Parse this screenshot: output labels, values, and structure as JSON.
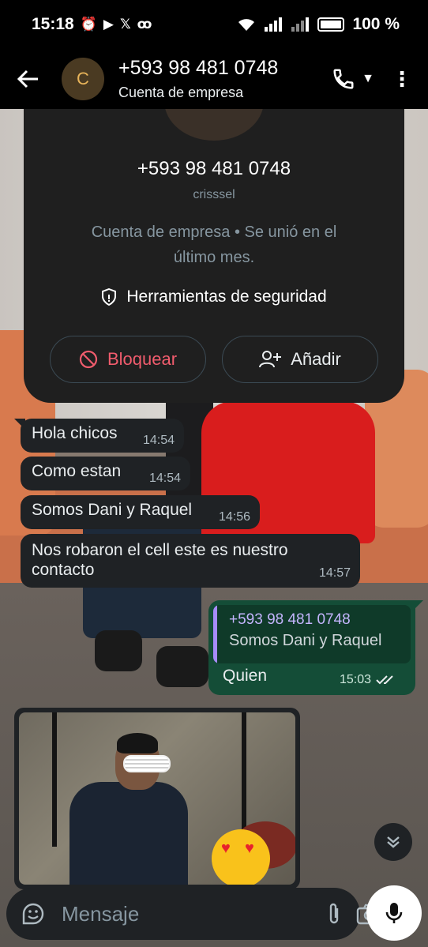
{
  "status_bar": {
    "time": "15:18",
    "battery": "100 %",
    "icons": [
      "alarm-icon",
      "youtube-icon",
      "x-icon",
      "voicemail-icon",
      "wifi-icon",
      "signal-icon",
      "signal-icon",
      "battery-icon"
    ]
  },
  "header": {
    "avatar_letter": "C",
    "title": "+593 98 481 0748",
    "subtitle": "Cuenta de empresa"
  },
  "contact_card": {
    "phone": "+593 98 481 0748",
    "name": "crisssel",
    "description": "Cuenta de empresa • Se unió en el último mes.",
    "security_label": "Herramientas de seguridad",
    "block_label": "Bloquear",
    "add_label": "Añadir"
  },
  "messages": [
    {
      "text": "Hola chicos",
      "time": "14:54"
    },
    {
      "text": "Como estan",
      "time": "14:54"
    },
    {
      "text": "Somos Dani y Raquel",
      "time": "14:56"
    },
    {
      "text": "Nos robaron el cell este es nuestro contacto",
      "time": "14:57"
    }
  ],
  "outgoing": {
    "quote_name": "+593 98 481 0748",
    "quote_text": "Somos Dani y Raquel",
    "text": "Quien",
    "time": "15:03",
    "status": "read"
  },
  "composer": {
    "placeholder": "Mensaje"
  },
  "colors": {
    "header_bg": "#000000",
    "incoming_bubble": "#1f2225",
    "outgoing_bubble": "#144d37",
    "danger": "#f15c6d",
    "quote_accent": "#a78bfa"
  }
}
